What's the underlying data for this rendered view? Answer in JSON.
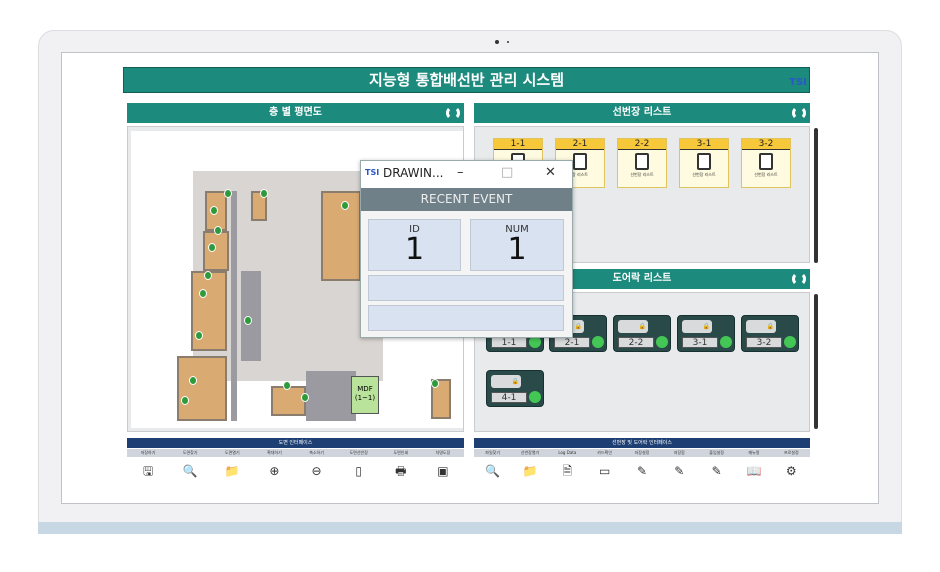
{
  "window": {
    "title": "지능형 통합배선반 관리 시스템",
    "logo_text": "TSI"
  },
  "floor_panel": {
    "title": "층 별 평면도",
    "mdf_label": "MDF\n(1~1)"
  },
  "cabinet_panel": {
    "title": "선번장 리스트",
    "cabinets": [
      {
        "label": "1-1",
        "caption": ""
      },
      {
        "label": "2-1",
        "caption": "장 리스트"
      },
      {
        "label": "2-2",
        "caption": "선번장 리스트"
      },
      {
        "label": "3-1",
        "caption": "선번장 리스트"
      },
      {
        "label": "3-2",
        "caption": "선번장 리스트"
      }
    ]
  },
  "door_panel": {
    "title": "도어락 리스트",
    "doors": [
      {
        "label": "1-1"
      },
      {
        "label": "2-1"
      },
      {
        "label": "2-2"
      },
      {
        "label": "3-1"
      },
      {
        "label": "3-2"
      },
      {
        "label": "4-1"
      }
    ]
  },
  "left_interface": {
    "title": "도면 인터페이스",
    "labels": [
      "저장하기",
      "도면찾기",
      "도면열기",
      "확대하기",
      "축소하기",
      "도면선반장",
      "도면인쇄",
      "차명도장"
    ],
    "icons": [
      "save-icon",
      "search-icon",
      "folder-icon",
      "zoom-in-icon",
      "zoom-out-icon",
      "cabinet-icon",
      "print-icon",
      "stamp-icon"
    ],
    "glyphs": [
      "🖫",
      "🔍",
      "📁",
      "⊕",
      "⊖",
      "▯",
      "🖶",
      "▣"
    ]
  },
  "right_interface": {
    "title": "선번장 및 도어락 인터페이스",
    "labels": [
      "파일찾기",
      "선번장열기",
      "Log Data",
      "카드확인",
      "저장설정",
      "저장함",
      "출입설정",
      "매뉴얼",
      "프로설정"
    ],
    "icons": [
      "search-icon",
      "folder-icon",
      "log-icon",
      "card-icon",
      "edit-icon",
      "edit-icon",
      "edit-icon",
      "manual-icon",
      "settings-icon"
    ],
    "glyphs": [
      "🔍",
      "📁",
      "🗎",
      "▭",
      "✎",
      "✎",
      "✎",
      "📖",
      "⚙"
    ]
  },
  "popup": {
    "title": "DRAWIN...",
    "header": "RECENT EVENT",
    "id_label": "ID",
    "id_value": "1",
    "num_label": "NUM",
    "num_value": "1",
    "minimize": "–",
    "maximize": "□",
    "close": "✕"
  },
  "colors": {
    "accent": "#1c8a7d",
    "interface_header": "#1d3f73",
    "popup_header": "#6f8088"
  }
}
